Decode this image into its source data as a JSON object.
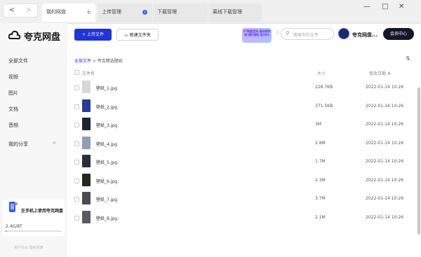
{
  "tabs": [
    {
      "label": "我的网盘",
      "icon": "refresh-icon"
    },
    {
      "label": "上传管理",
      "icon": "info-icon"
    },
    {
      "label": "下载管理"
    },
    {
      "label": "离线下载管理"
    }
  ],
  "nav": {
    "back": "<",
    "forward": ">"
  },
  "window": {
    "minimize": "—",
    "maximize": "□",
    "close": "✕"
  },
  "brand": {
    "name": "夸克网盘"
  },
  "sidebar": {
    "items": [
      "全部文件",
      "视频",
      "图片",
      "文档",
      "音频"
    ],
    "share": "我的分享",
    "promo_text": "在手机上使用夸克网盘",
    "storage": "2.4G/8T",
    "storage_fraction": 0.0003,
    "footer": "用户协议   隐私政策"
  },
  "toolbar": {
    "upload_label": "+ 上传文件",
    "newfolder_label": "新建文件夹",
    "promo_badge": "1T网盘空间 星标限时领 限时领取 送19元",
    "search_placeholder": "搜索你的文件",
    "username": "夸克网盘...",
    "vip_label": "会员中心"
  },
  "breadcrumb": {
    "root": "全部文件",
    "sep": ">",
    "current": "夸克精选壁纸"
  },
  "table": {
    "headers": {
      "name": "文件名",
      "size": "大小",
      "date": "修改日期 ⬇"
    },
    "rows": [
      {
        "name": "壁纸_1.jpg",
        "size": "228.7KB",
        "date": "2022-01-14 10:26",
        "thumb": "#d8d8dc"
      },
      {
        "name": "壁纸_2.jpg",
        "size": "371.5KB",
        "date": "2022-01-14 10:26",
        "thumb": "#2a3a9a"
      },
      {
        "name": "壁纸_3.jpg",
        "size": "3M",
        "date": "2022-01-14 10:26",
        "thumb": "#1c2430"
      },
      {
        "name": "壁纸_4.jpg",
        "size": "2.8M",
        "date": "2022-01-14 10:26",
        "thumb": "#8fa0b8"
      },
      {
        "name": "壁纸_5.jpg",
        "size": "1.7M",
        "date": "2022-01-14 10:26",
        "thumb": "#26303a"
      },
      {
        "name": "壁纸_6.jpg",
        "size": "2.3M",
        "date": "2022-01-14 10:26",
        "thumb": "#1e2a1e"
      },
      {
        "name": "壁纸_7.jpg",
        "size": "3.7M",
        "date": "2022-01-14 10:26",
        "thumb": "#4a4a52"
      },
      {
        "name": "壁纸_8.jpg",
        "size": "2.1M",
        "date": "2022-01-14 10:26",
        "thumb": "#5a5a62"
      }
    ]
  },
  "colors": {
    "accent": "#1f34d9",
    "vip": "#14162a"
  }
}
